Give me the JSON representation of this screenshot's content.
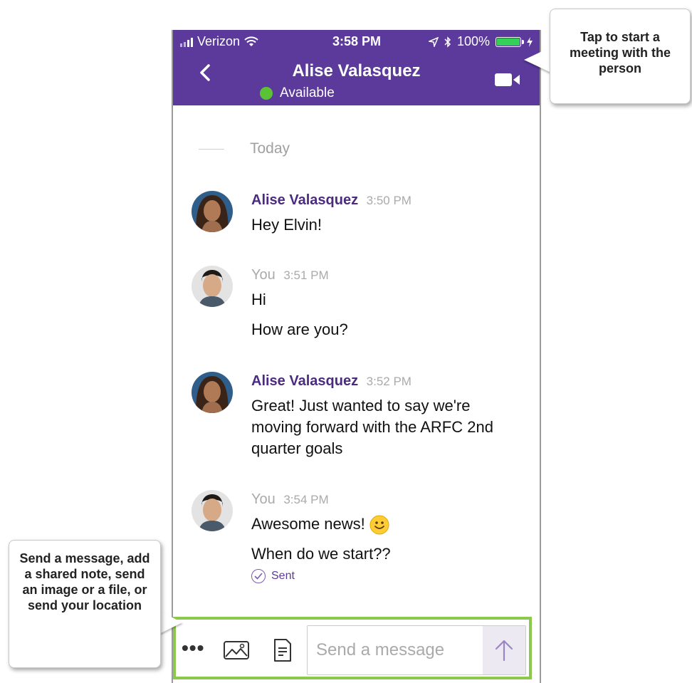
{
  "status_bar": {
    "carrier": "Verizon",
    "time": "3:58 PM",
    "battery": "100%",
    "battery_level": 1.0
  },
  "header": {
    "contact_name": "Alise Valasquez",
    "presence": "Available",
    "back_icon": "chevron-left-icon",
    "video_icon": "video-camera-icon"
  },
  "conversation": {
    "date_divider": "Today",
    "messages": [
      {
        "sender": "Alise Valasquez",
        "time": "3:50 PM",
        "texts": [
          "Hey Elvin!"
        ]
      },
      {
        "sender": "You",
        "time": "3:51 PM",
        "texts": [
          "Hi",
          "How are you?"
        ]
      },
      {
        "sender": "Alise Valasquez",
        "time": "3:52 PM",
        "texts": [
          "Great! Just wanted to say we're moving forward with the ARFC 2nd quarter goals"
        ]
      },
      {
        "sender": "You",
        "time": "3:54 PM",
        "texts": [
          "Awesome news!",
          "When do we start??"
        ],
        "status": "Sent"
      }
    ]
  },
  "composer": {
    "placeholder": "Send a message",
    "more_label": "•••",
    "icons": [
      "more-icon",
      "image-icon",
      "note-icon",
      "send-arrow-icon"
    ]
  },
  "callouts": {
    "top": "Tap to start a meeting with the person",
    "bottom": "Send a message, add a shared note, send an image or a file, or send your location"
  },
  "colors": {
    "brand_purple": "#5b3a9b",
    "presence_green": "#5bc236",
    "highlight_green": "#8cc84b",
    "battery_green": "#35d05a"
  }
}
